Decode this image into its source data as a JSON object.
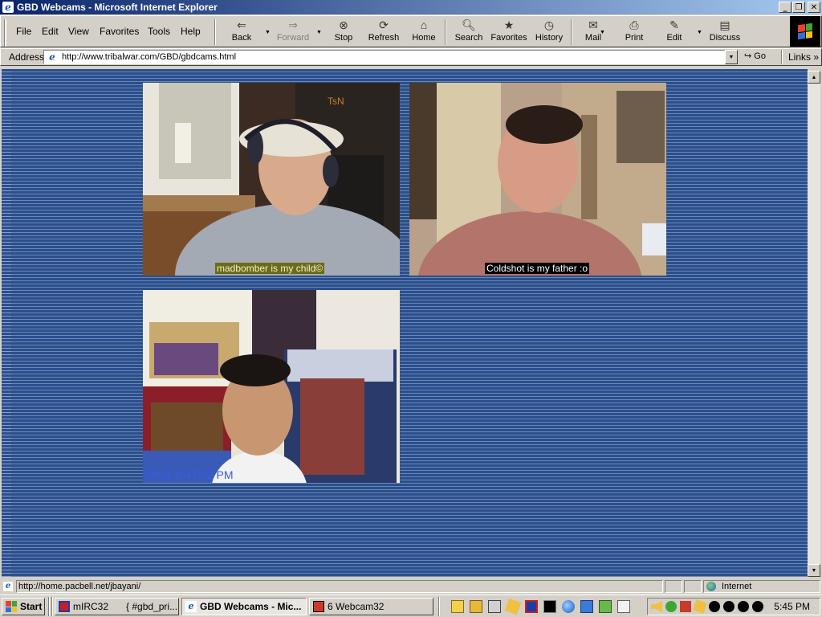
{
  "window": {
    "title": "GBD Webcams - Microsoft Internet Explorer",
    "minimize": "_",
    "maximize": "❐",
    "close": "✕"
  },
  "menu": [
    "File",
    "Edit",
    "View",
    "Favorites",
    "Tools",
    "Help"
  ],
  "toolbar": {
    "back": "Back",
    "forward": "Forward",
    "stop": "Stop",
    "refresh": "Refresh",
    "home": "Home",
    "search": "Search",
    "favorites": "Favorites",
    "history": "History",
    "mail": "Mail",
    "print": "Print",
    "edit": "Edit",
    "discuss": "Discuss"
  },
  "address": {
    "label": "Address",
    "url": "http://www.tribalwar.com/GBD/gbdcams.html",
    "go": "Go",
    "links": "Links"
  },
  "webcams": [
    {
      "overlay_tag": "TsN",
      "caption": "madbomber is my child©"
    },
    {
      "caption": "Coldshot is my father :o"
    },
    {
      "overlay_timestamp": "/2001 8:47:02 PM"
    }
  ],
  "status": {
    "text": "http://home.pacbell.net/jbayani/",
    "zone": "Internet"
  },
  "taskbar": {
    "start": "Start",
    "tasks": [
      {
        "label": "mIRC32"
      },
      {
        "label": "{ #gbd_pri..."
      },
      {
        "label": "GBD Webcams - Mic..."
      },
      {
        "label": "6 Webcam32"
      }
    ],
    "clock": "5:45 PM"
  },
  "colors": {
    "titlebar_start": "#0a246a",
    "titlebar_end": "#a6caf0",
    "page_background": "#264a84",
    "caption_1_bg": "#6b6b1a",
    "caption_2_bg": "#000000"
  }
}
